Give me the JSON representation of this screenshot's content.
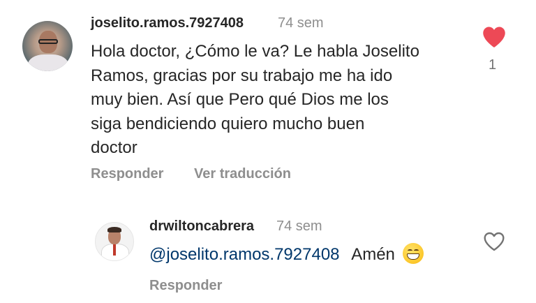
{
  "comments": [
    {
      "username": "joselito.ramos.7927408",
      "time": "74 sem",
      "text": [
        "Hola doctor, ¿Cómo le va? Le habla Joselito",
        "Ramos, gracias por su trabajo me ha ido",
        "muy bien. Así que Pero qué Dios me los",
        "siga bendiciendo quiero mucho buen",
        "doctor"
      ],
      "actions": {
        "reply": "Responder",
        "translate": "Ver traducción"
      },
      "likes": "1",
      "liked": true
    },
    {
      "username": "drwiltoncabrera",
      "time": "74 sem",
      "mention": "@joselito.ramos.7927408",
      "text": "Amén",
      "emoji": "grinning-face",
      "actions": {
        "reply": "Responder"
      },
      "liked": false
    }
  ],
  "colors": {
    "heart_liked": "#ed4956",
    "muted_text": "#8e8e8e",
    "mention": "#00376b"
  }
}
